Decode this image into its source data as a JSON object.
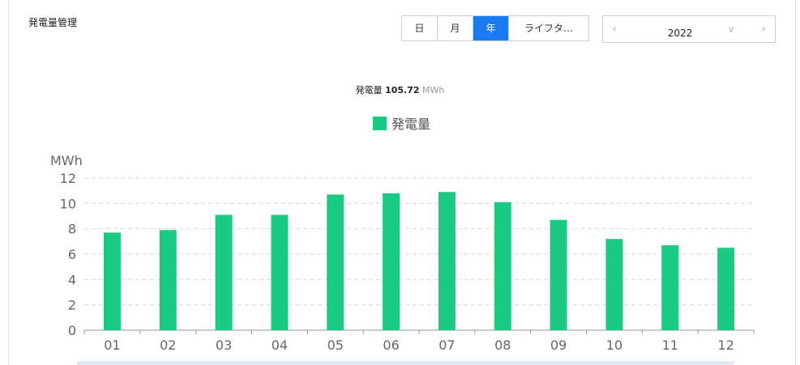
{
  "header": {
    "title": "発電量管理"
  },
  "period_tabs": [
    {
      "label": "日",
      "active": false
    },
    {
      "label": "月",
      "active": false
    },
    {
      "label": "年",
      "active": true
    },
    {
      "label": "ライフタ…",
      "active": false
    }
  ],
  "date_picker": {
    "prev_icon": "chevron-left-icon",
    "next_icon": "chevron-right-icon",
    "dropdown_icon": "chevron-down-icon",
    "value": "2022"
  },
  "summary": {
    "label": "発電量",
    "value": "105.72",
    "unit": "MWh"
  },
  "colors": {
    "accent": "#1a7bf2",
    "bar": "#1bcb84"
  },
  "chart_data": {
    "type": "bar",
    "categories": [
      "01",
      "02",
      "03",
      "04",
      "05",
      "06",
      "07",
      "08",
      "09",
      "10",
      "11",
      "12"
    ],
    "series": [
      {
        "name": "発電量",
        "values": [
          7.7,
          7.9,
          9.1,
          9.1,
          10.7,
          10.8,
          10.9,
          10.1,
          8.7,
          7.2,
          6.7,
          6.5
        ]
      }
    ],
    "ylabel": "MWh",
    "ylim": [
      0,
      12
    ],
    "yticks": [
      "0",
      "2",
      "4",
      "6",
      "8",
      "10",
      "12"
    ],
    "grid": true,
    "legend_position": "top-center"
  }
}
